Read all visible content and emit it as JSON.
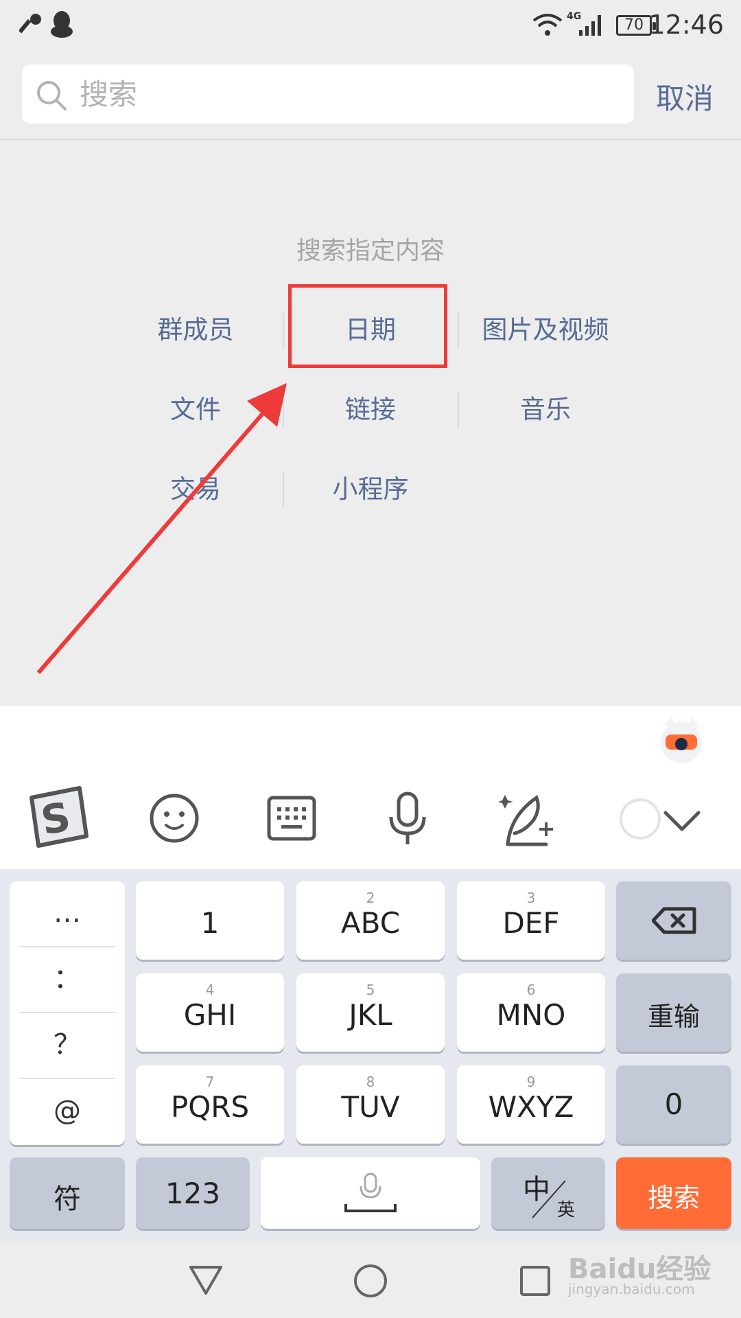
{
  "status_bar": {
    "time": "12:46",
    "network": "4G",
    "battery": "70"
  },
  "search": {
    "placeholder": "搜索",
    "cancel_label": "取消"
  },
  "section": {
    "title": "搜索指定内容",
    "categories": [
      "群成员",
      "日期",
      "图片及视频",
      "文件",
      "链接",
      "音乐",
      "交易",
      "小程序"
    ],
    "highlighted": "日期"
  },
  "keyboard": {
    "symbols": [
      "…",
      "：",
      "？",
      "@"
    ],
    "keys": [
      {
        "num": "",
        "label": "1"
      },
      {
        "num": "2",
        "label": "ABC"
      },
      {
        "num": "3",
        "label": "DEF"
      },
      {
        "num": "4",
        "label": "GHI"
      },
      {
        "num": "5",
        "label": "JKL"
      },
      {
        "num": "6",
        "label": "MNO"
      },
      {
        "num": "7",
        "label": "PQRS"
      },
      {
        "num": "8",
        "label": "TUV"
      },
      {
        "num": "9",
        "label": "WXYZ"
      }
    ],
    "reinput_label": "重输",
    "zero_label": "0",
    "symbol_key_label": "符",
    "num_key_label": "123",
    "lang_main": "中",
    "lang_sub": "英",
    "search_key_label": "搜索"
  },
  "toolbar_icons": [
    "sogou-logo-icon",
    "emoji-icon",
    "keyboard-icon",
    "microphone-icon",
    "handwriting-icon",
    "search-circle-icon",
    "chevron-down-icon"
  ],
  "watermark": {
    "text": "Baidu经验",
    "url": "jingyan.baidu.com"
  },
  "colors": {
    "link": "#576b95",
    "highlight": "#ef3a3a",
    "search_key": "#ff6c35"
  }
}
